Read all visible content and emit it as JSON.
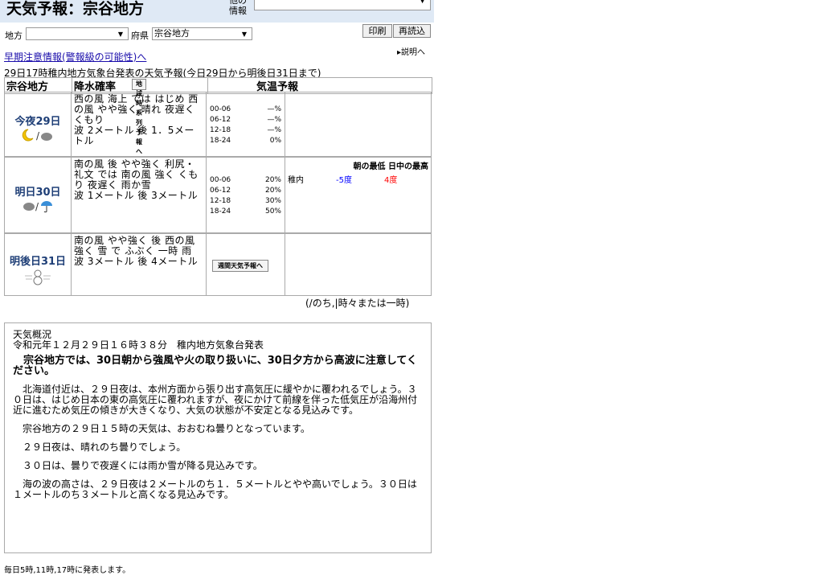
{
  "header": {
    "title": "天気予報：宗谷地方",
    "other_label": "他の\n情報",
    "other_select_value": ""
  },
  "controls": {
    "area_label": "地方",
    "area_value": "",
    "pref_label": "府県",
    "pref_value": "宗谷地方",
    "print_button": "印刷",
    "reload_button": "再読込",
    "help_link": "▸説明へ",
    "early_warning_link": "早期注意情報(警報級の可能性)へ"
  },
  "forecast": {
    "caption": "29日17時稚内地方気象台発表の天気予報(今日29日から明後日31日まで)",
    "col_area": "宗谷地方",
    "col_area_button": "地域時系列予報へ",
    "col_pop": "降水確率",
    "col_temp": "気温予報",
    "days": [
      {
        "name": "今夜29日",
        "icon": "moon-cloud-icon",
        "weather": "西の風 海上 では はじめ 西の風 やや強く 晴れ 夜遅く くもり\n波 2メートル 後 1．5メートル",
        "pop": [
          [
            "00-06",
            "—%"
          ],
          [
            "06-12",
            "—%"
          ],
          [
            "12-18",
            "—%"
          ],
          [
            "18-24",
            "0%"
          ]
        ],
        "temp": null
      },
      {
        "name": "明日30日",
        "icon": "cloud-umbrella-icon",
        "weather": "南の風 後 やや強く 利尻・礼文 では 南の風 強く くもり 夜遅く 雨か雪\n波 1メートル 後 3メートル",
        "pop": [
          [
            "00-06",
            "20%"
          ],
          [
            "06-12",
            "20%"
          ],
          [
            "12-18",
            "30%"
          ],
          [
            "18-24",
            "50%"
          ]
        ],
        "temp": {
          "head_low": "朝の最低",
          "head_high": "日中の最高",
          "city": "稚内",
          "low": "-5度",
          "high": "4度"
        }
      },
      {
        "name": "明後日31日",
        "icon": "snowman-wind-icon",
        "weather": "南の風 やや強く 後 西の風 強く 雪 で ふぶく 一時 雨\n波 3メートル 後 4メートル",
        "week_button": "週間天気予報へ"
      }
    ],
    "legend": "(/のち,|時々または一時)"
  },
  "overview": {
    "title": "天気概況",
    "issued": "令和元年１２月２９日１６時３８分　稚内地方気象台発表",
    "headline": "宗谷地方では、30日朝から強風や火の取り扱いに、30日夕方から高波に注意してください。",
    "paragraphs": [
      "北海道付近は、２９日夜は、本州方面から張り出す高気圧に緩やかに覆われるでしょう。３０日は、はじめ日本の東の高気圧に覆われますが、夜にかけて前線を伴った低気圧が沿海州付近に進むため気圧の傾きが大きくなり、大気の状態が不安定となる見込みです。",
      "宗谷地方の２９日１５時の天気は、おおむね曇りとなっています。",
      "２９日夜は、晴れのち曇りでしょう。",
      "３０日は、曇りで夜遅くには雨か雪が降る見込みです。",
      "海の波の高さは、２９日夜は２メートルのち１．５メートルとやや高いでしょう。３０日は１メートルのち３メートルと高くなる見込みです。"
    ]
  },
  "footer": "毎日5時,11時,17時に発表します。",
  "colors": {
    "low": "#0000ff",
    "high": "#ff0000",
    "link": "#1a0dab",
    "header_bg": "#dfe9f5"
  }
}
